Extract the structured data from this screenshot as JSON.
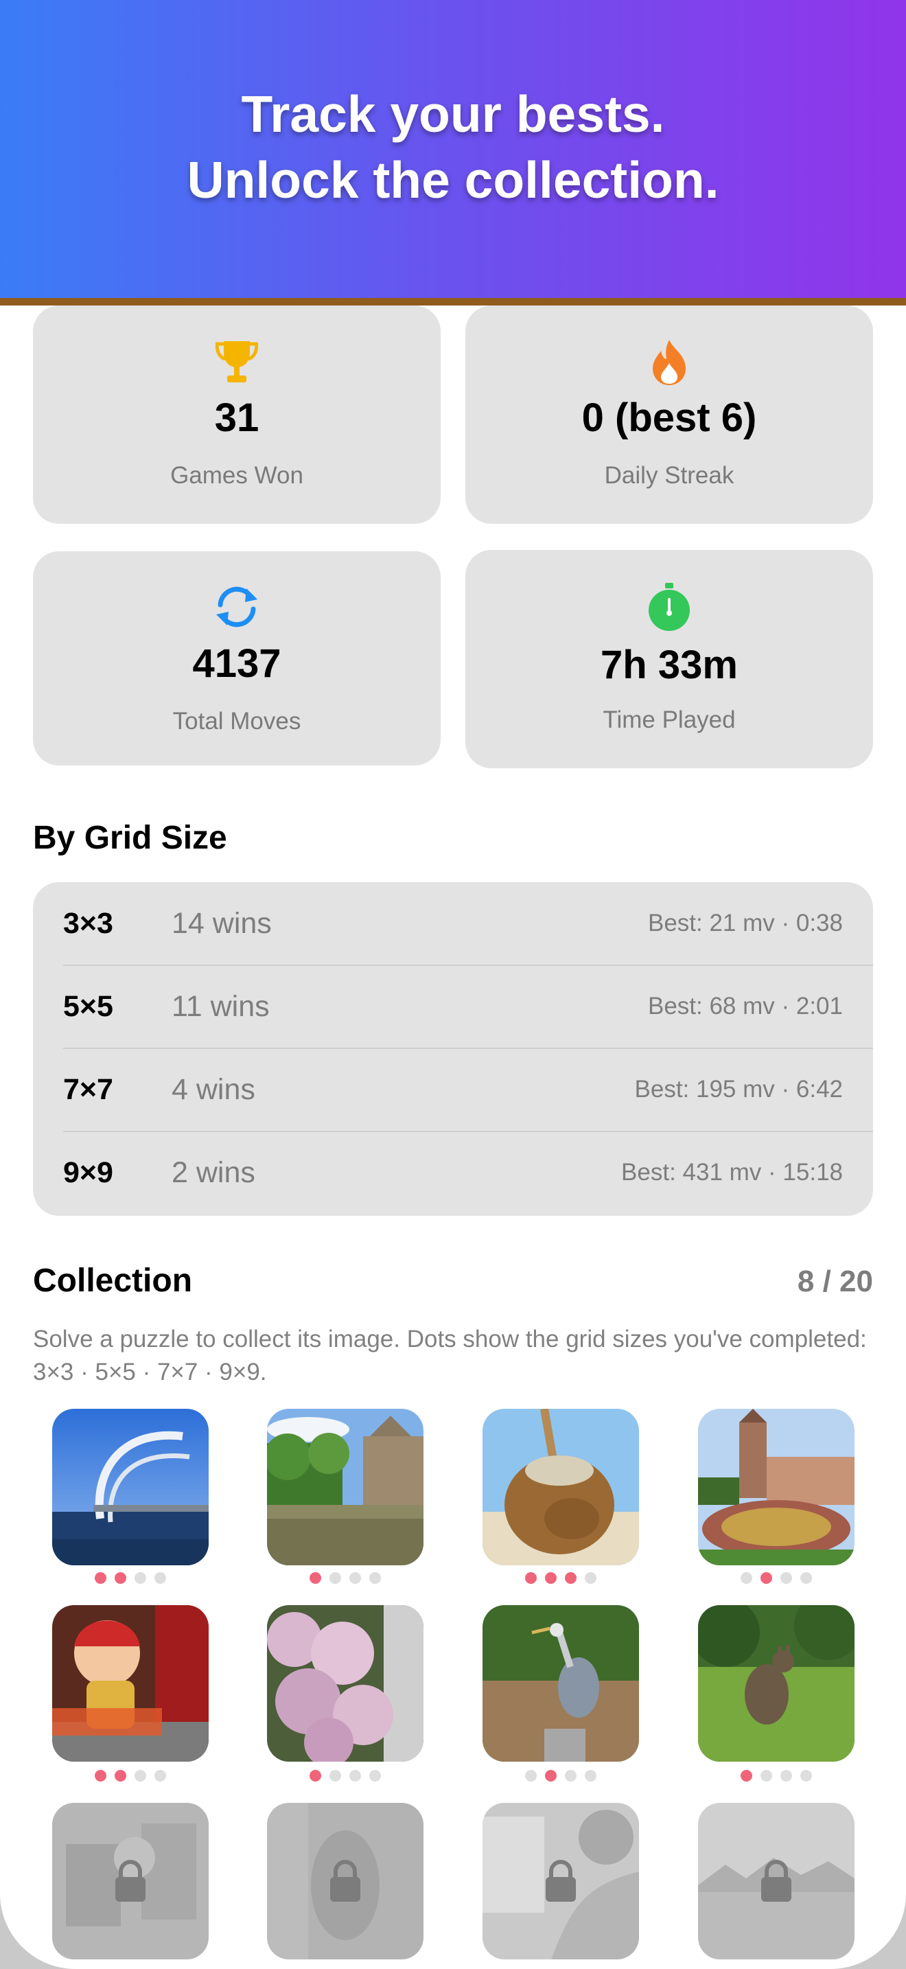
{
  "header": {
    "line1": "Track your bests.",
    "line2": "Unlock the collection."
  },
  "stats": [
    {
      "icon": "trophy-icon",
      "value": "31",
      "label": "Games Won",
      "color": "#f5b400"
    },
    {
      "icon": "flame-icon",
      "value": "0 (best 6)",
      "label": "Daily Streak",
      "color": "#f57f26"
    },
    {
      "icon": "refresh-icon",
      "value": "4137",
      "label": "Total Moves",
      "color": "#1e8ef5"
    },
    {
      "icon": "stopwatch-icon",
      "value": "7h 33m",
      "label": "Time Played",
      "color": "#34c759"
    }
  ],
  "grid_section": {
    "title": "By Grid Size",
    "rows": [
      {
        "size": "3×3",
        "wins": "14 wins",
        "best": "Best: 21 mv · 0:38"
      },
      {
        "size": "5×5",
        "wins": "11 wins",
        "best": "Best: 68 mv · 2:01"
      },
      {
        "size": "7×7",
        "wins": "4 wins",
        "best": "Best: 195 mv · 6:42"
      },
      {
        "size": "9×9",
        "wins": "2 wins",
        "best": "Best: 431 mv · 15:18"
      }
    ]
  },
  "collection": {
    "title": "Collection",
    "count": "8 / 20",
    "description": "Solve a puzzle to collect its image. Dots show the grid sizes you've completed: 3×3 · 5×5 · 7×7 · 9×9.",
    "dot_active_color": "#f0647a",
    "items": [
      {
        "name": "bridge-arch",
        "dots": [
          1,
          1,
          0,
          0
        ],
        "locked": false
      },
      {
        "name": "canal",
        "dots": [
          1,
          0,
          0,
          0
        ],
        "locked": false
      },
      {
        "name": "coconut",
        "dots": [
          1,
          1,
          1,
          0
        ],
        "locked": false
      },
      {
        "name": "clock-garden",
        "dots": [
          0,
          1,
          0,
          0
        ],
        "locked": false
      },
      {
        "name": "doll-figure",
        "dots": [
          1,
          1,
          0,
          0
        ],
        "locked": false
      },
      {
        "name": "flower-bush",
        "dots": [
          1,
          0,
          0,
          0
        ],
        "locked": false
      },
      {
        "name": "heron",
        "dots": [
          0,
          1,
          0,
          0
        ],
        "locked": false
      },
      {
        "name": "kangaroo",
        "dots": [
          1,
          0,
          0,
          0
        ],
        "locked": false
      },
      {
        "name": "locked-1",
        "locked": true
      },
      {
        "name": "locked-2",
        "locked": true
      },
      {
        "name": "locked-3",
        "locked": true
      },
      {
        "name": "locked-4",
        "locked": true
      }
    ]
  }
}
